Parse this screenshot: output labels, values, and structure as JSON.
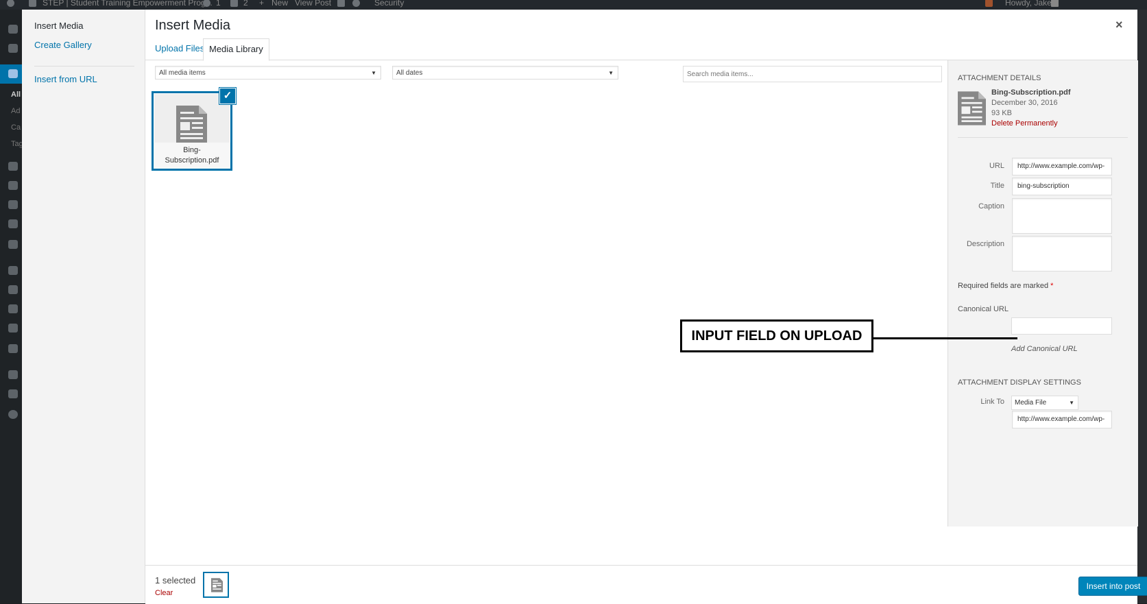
{
  "adminbar": {
    "site_title": "STEP | Student Training Empowerment Prog...",
    "updates": "1",
    "comments": "2",
    "new_label": "New",
    "view_post": "View Post",
    "security": "Security",
    "howdy": "Howdy, Jake"
  },
  "admin_menu": {
    "items": [
      "All",
      "Ad",
      "Ca",
      "Tag"
    ]
  },
  "modal": {
    "title": "Insert Media",
    "close_label": "×"
  },
  "left_menu": {
    "insert_media": "Insert Media",
    "create_gallery": "Create Gallery",
    "insert_from_url": "Insert from URL"
  },
  "tabs": {
    "upload_files": "Upload Files",
    "media_library": "Media Library"
  },
  "filters": {
    "media_type": "All media items",
    "dates": "All dates",
    "search_placeholder": "Search media items..."
  },
  "attachments": [
    {
      "filename_line1": "Bing-",
      "filename_line2": "Subscription.pdf",
      "selected": true
    }
  ],
  "details": {
    "heading": "Attachment Details",
    "filename": "Bing-Subscription.pdf",
    "date": "December 30, 2016",
    "size": "93 KB",
    "delete_label": "Delete Permanently",
    "url_label": "URL",
    "url_value": "http://www.example.com/wp-",
    "title_label": "Title",
    "title_value": "bing-subscription",
    "caption_label": "Caption",
    "description_label": "Description",
    "required_text": "Required fields are marked",
    "required_star": "*",
    "canonical_label": "Canonical URL",
    "canonical_add": "Add Canonical URL"
  },
  "display_settings": {
    "heading": "Attachment Display Settings",
    "link_to_label": "Link To",
    "link_to_value": "Media File",
    "link_url": "http://www.example.com/wp-"
  },
  "annotation": {
    "text": "INPUT FIELD ON UPLOAD"
  },
  "toolbar": {
    "selected_count": "1 selected",
    "clear_label": "Clear",
    "insert_label": "Insert into post"
  },
  "colors": {
    "accent": "#0073aa",
    "button": "#0085ba",
    "delete": "#a00000"
  }
}
